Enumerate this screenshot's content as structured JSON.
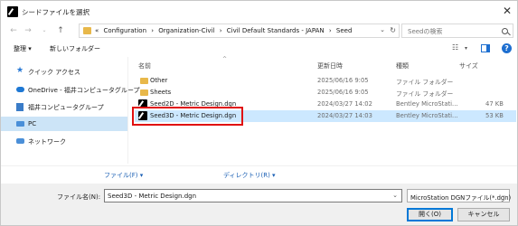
{
  "window": {
    "title": "シードファイルを選択",
    "close_glyph": "✕"
  },
  "address": {
    "crumbs": [
      "«",
      "Configuration",
      "›",
      "Organization-Civil",
      "›",
      "Civil Default Standards - JAPAN",
      "›",
      "Seed"
    ],
    "search_placeholder": "Seedの検索"
  },
  "toolbar": {
    "organize_label": "整理 ▾",
    "new_folder_label": "新しいフォルダー"
  },
  "nav_pane": {
    "items": [
      {
        "label": "クイック アクセス",
        "icon": "star-icon"
      },
      {
        "label": "OneDrive - 福井コンピュータグループ",
        "icon": "cloud-icon"
      },
      {
        "label": "福井コンピュータグループ",
        "icon": "building-icon"
      },
      {
        "label": "PC",
        "icon": "pc-icon"
      },
      {
        "label": "ネットワーク",
        "icon": "network-icon"
      }
    ]
  },
  "file_list": {
    "columns": {
      "name": "名前",
      "modified": "更新日時",
      "type": "種類",
      "size": "サイズ"
    },
    "rows": [
      {
        "name": "Other",
        "modified": "2025/06/16 9:05",
        "type": "ファイル フォルダー",
        "size": "",
        "icon": "folder-icon"
      },
      {
        "name": "Sheets",
        "modified": "2025/06/16 9:05",
        "type": "ファイル フォルダー",
        "size": "",
        "icon": "folder-icon"
      },
      {
        "name": "Seed2D - Metric Design.dgn",
        "modified": "2024/03/27 14:02",
        "type": "Bentley MicroStati...",
        "size": "47 KB",
        "icon": "dgn-file-icon"
      },
      {
        "name": "Seed3D - Metric Design.dgn",
        "modified": "2024/03/27 14:03",
        "type": "Bentley MicroStati...",
        "size": "53 KB",
        "icon": "dgn-file-icon"
      }
    ]
  },
  "options": {
    "file_btn": "ファイル(F) ▾",
    "dir_btn": "ディレクトリ(R) ▾"
  },
  "footer": {
    "filename_label": "ファイル名(N):",
    "filename_value": "Seed3D - Metric Design.dgn",
    "filetype_value": "MicroStation DGNファイル(*.dgn)",
    "open_label": "開く(O)",
    "cancel_label": "キャンセル"
  },
  "colors": {
    "selection": "#cce8ff",
    "highlight_border": "#e01010",
    "accent": "#0078d7"
  }
}
